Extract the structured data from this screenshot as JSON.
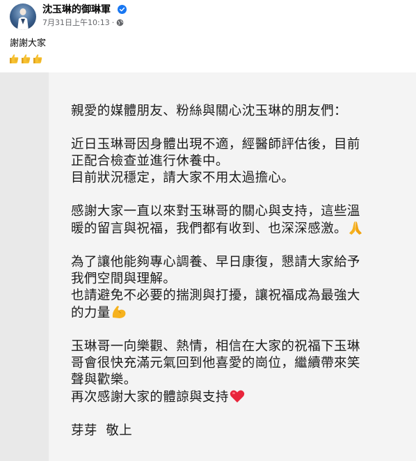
{
  "post": {
    "page_name": "沈玉琳的御琳軍",
    "timestamp": "7月31日上午10:13",
    "separator": "·",
    "text": "謝謝大家",
    "emoji_row": [
      "thumbs-up-icon",
      "thumbs-up-icon",
      "thumbs-up-icon"
    ]
  },
  "letter": {
    "greeting": "親愛的媒體朋友、粉絲與關心沈玉琳的朋友們：",
    "p1": [
      "近日玉琳哥因身體出現不適，經醫師評估後，目前",
      "正配合檢查並進行休養中。",
      "目前狀況穩定，請大家不用太過擔心。"
    ],
    "p2": [
      "感謝大家一直以來對玉琳哥的關心與支持，這些溫",
      "暖的留言與祝福，我們都有收到、也深深感激。"
    ],
    "p3": [
      "為了讓他能夠專心調養、早日康復，懇請大家給予",
      "我們空間與理解。",
      "也請避免不必要的揣測與打擾，讓祝福成為最強大",
      "的力量"
    ],
    "p4": [
      "玉琳哥一向樂觀、熱情，相信在大家的祝福下玉琳",
      "哥會很快充滿元氣回到他喜愛的崗位，繼續帶來笑",
      "聲與歡樂。",
      "再次感謝大家的體諒與支持"
    ],
    "signature": "芽芽  敬上"
  },
  "colors": {
    "verified": "#1877f2",
    "meta_text": "#65676b",
    "paper": "#f4f4f4",
    "heart": "#e8253b",
    "muscle": "#f6b21e",
    "hands": "#f6b21e"
  }
}
